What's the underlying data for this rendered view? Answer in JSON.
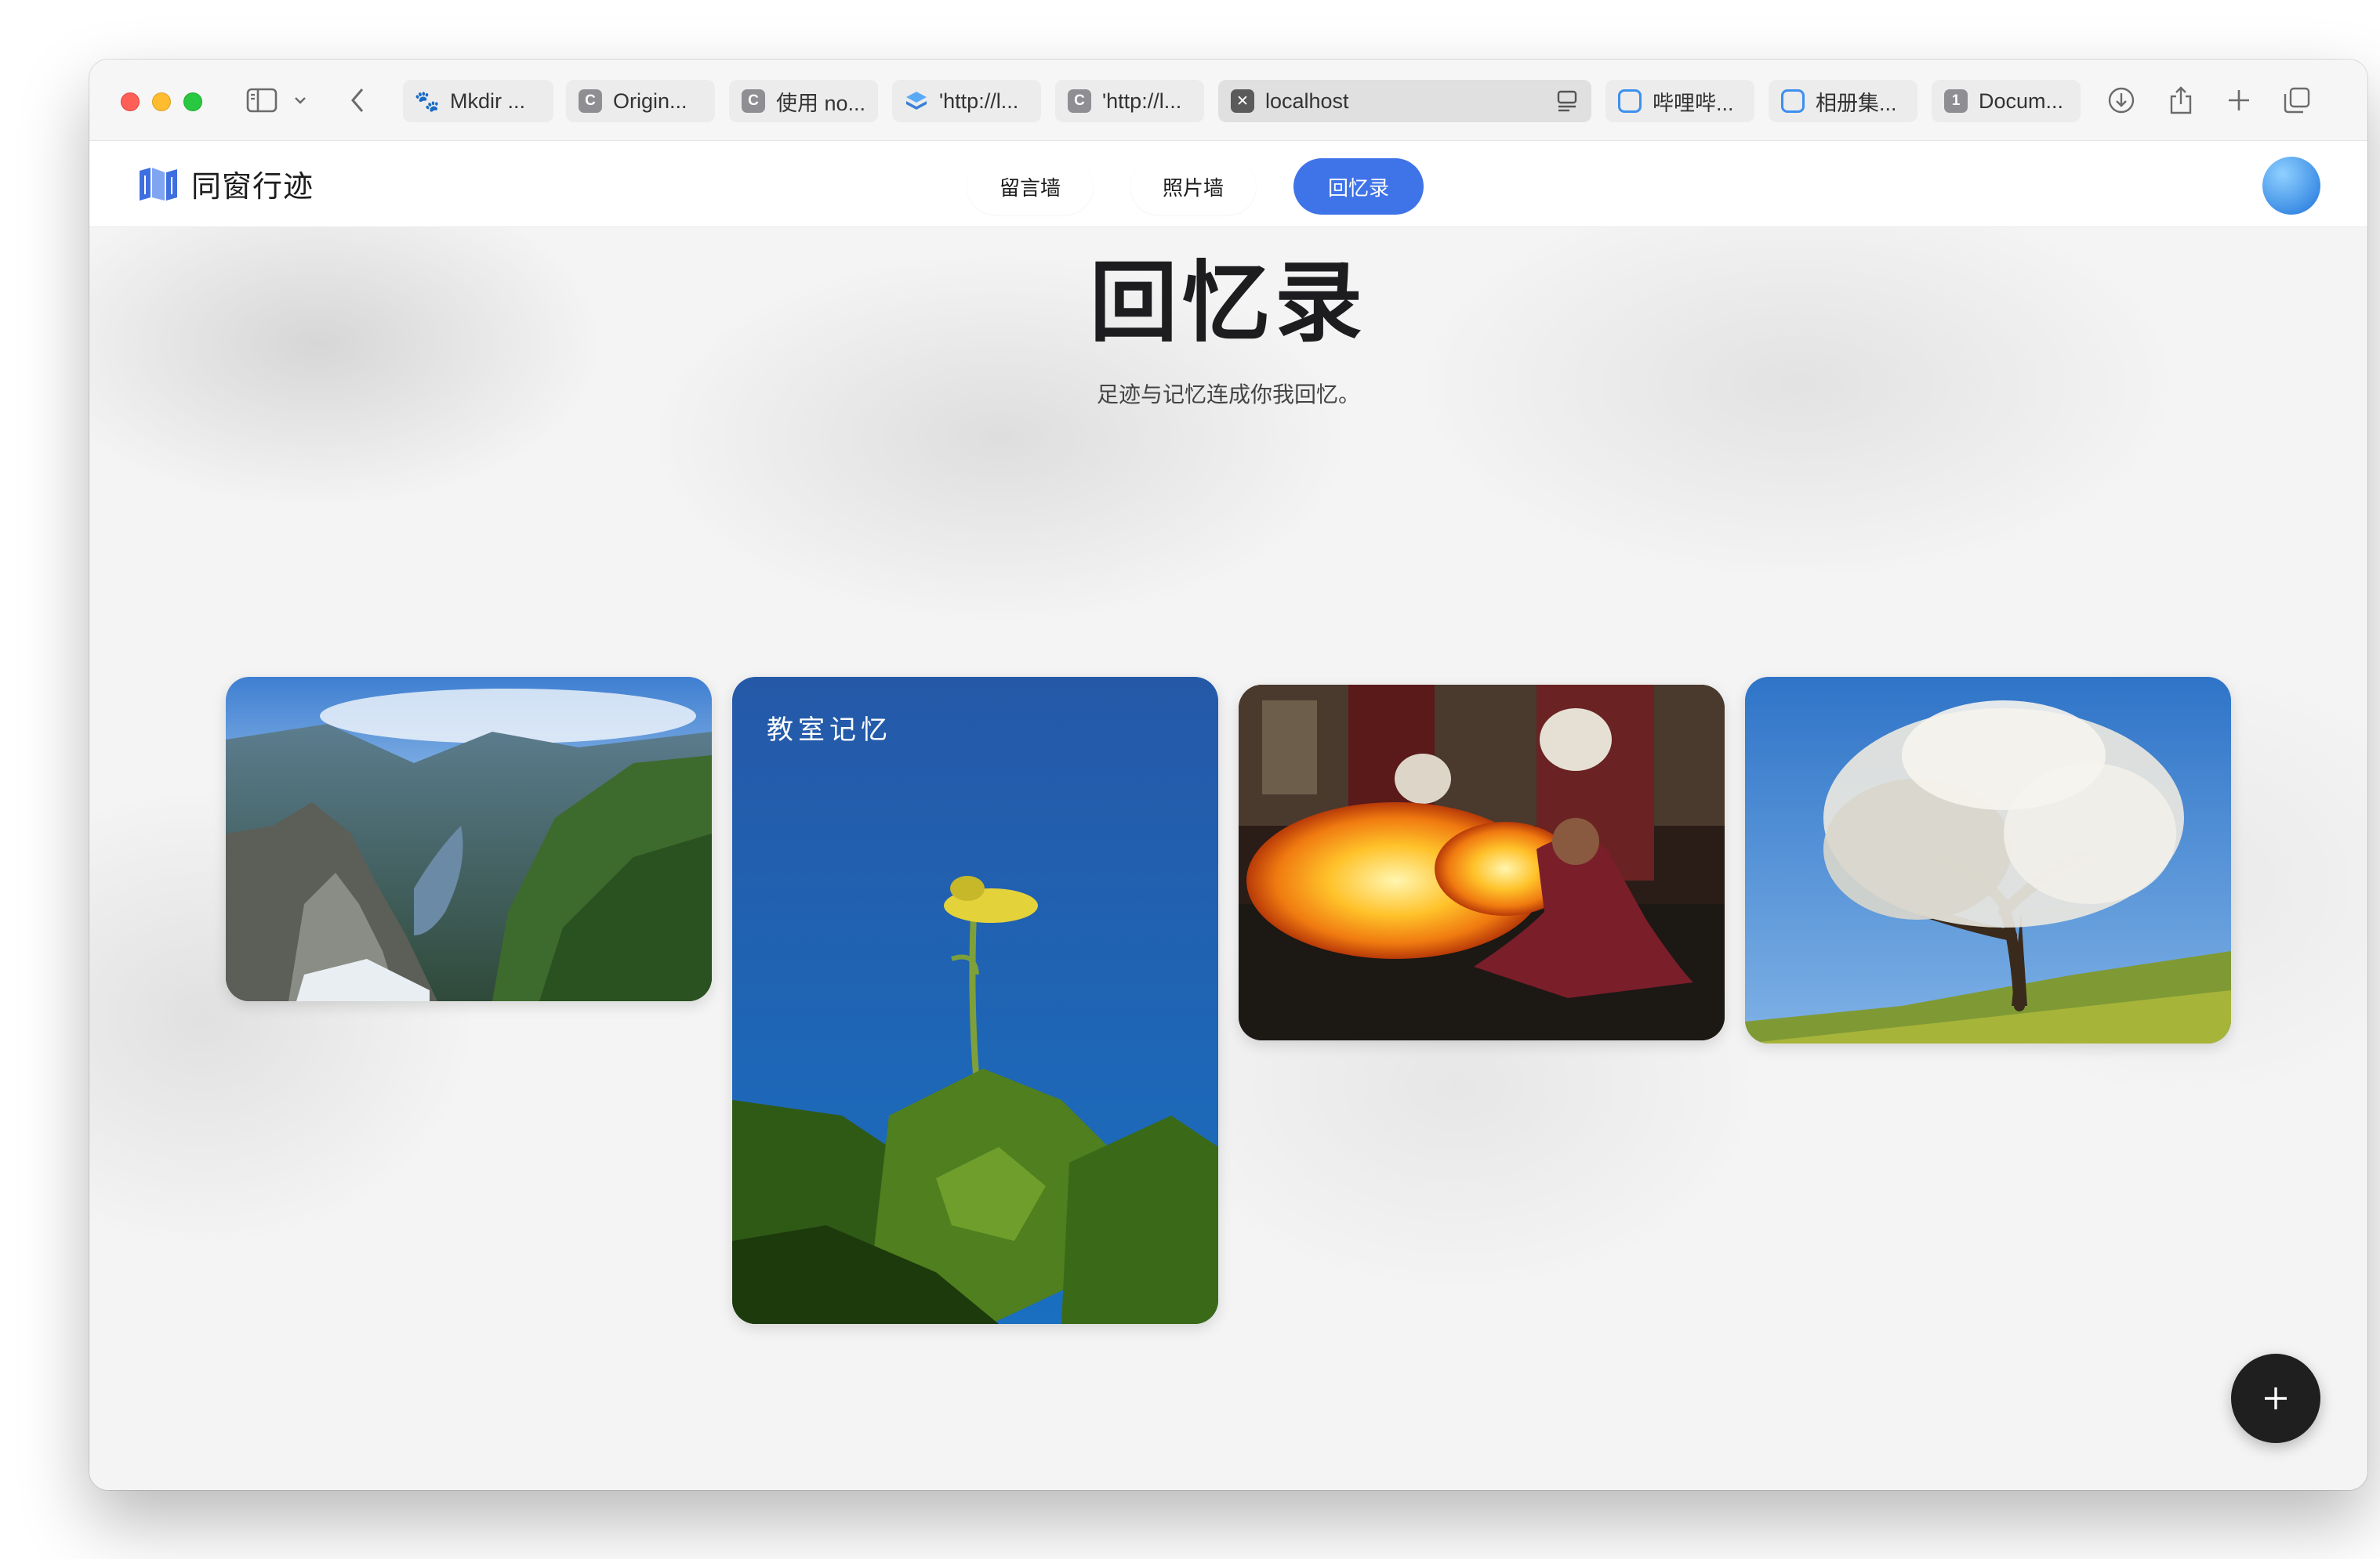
{
  "browser": {
    "tabs": [
      {
        "label": "Mkdir ...",
        "icon": "paw-icon"
      },
      {
        "label": "Origin...",
        "icon": "c-icon"
      },
      {
        "label": "使用 no...",
        "icon": "c-icon"
      },
      {
        "label": "'http://l...",
        "icon": "stack-icon"
      },
      {
        "label": "'http://l...",
        "icon": "c-icon"
      },
      {
        "label": "localhost",
        "icon": "close-icon"
      },
      {
        "label": "哔哩哔...",
        "icon": "bilibili-icon"
      },
      {
        "label": "相册集...",
        "icon": "bilibili-icon"
      },
      {
        "label": "Docum...",
        "icon": "one-icon"
      }
    ],
    "active_tab_index": 5
  },
  "site": {
    "brand": "同窗行迹",
    "nav": [
      "留言墙",
      "照片墙",
      "回忆录"
    ],
    "active_nav_index": 2
  },
  "hero": {
    "title": "回忆录",
    "subtitle": "足迹与记忆连成你我回忆。"
  },
  "cards": [
    {
      "image": "mountain-fjord-photo",
      "caption": ""
    },
    {
      "image": "yellow-flower-blue-sky-photo",
      "caption": "教室记忆"
    },
    {
      "image": "fire-breather-photo",
      "caption": ""
    },
    {
      "image": "blossoming-tree-photo",
      "caption": ""
    }
  ],
  "colors": {
    "accent": "#3f73e8",
    "fab": "#1f1f1f"
  }
}
